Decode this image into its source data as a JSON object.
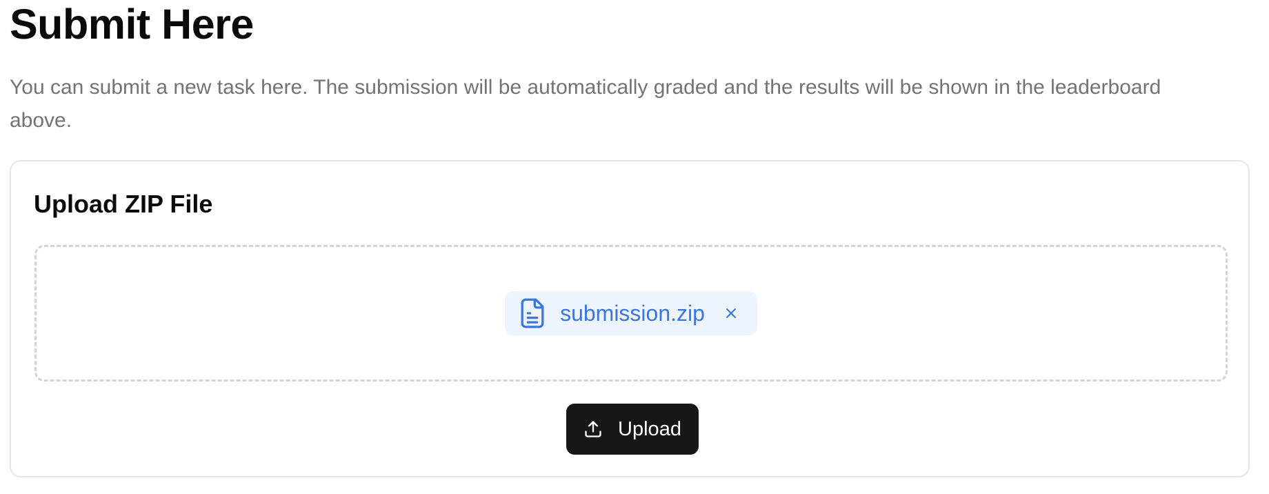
{
  "header": {
    "title": "Submit Here",
    "description": "You can submit a new task here. The submission will be automatically graded and the results will be shown in the leaderboard above."
  },
  "upload_card": {
    "title": "Upload ZIP File",
    "selected_file": {
      "name": "submission.zip",
      "icon": "file-text-icon",
      "remove_icon": "close-icon"
    },
    "upload_button": {
      "label": "Upload",
      "icon": "upload-icon"
    }
  },
  "colors": {
    "accent": "#3b76e0",
    "chip_background": "#eef4fd",
    "button_background": "#171717",
    "muted_text": "#737373",
    "border": "#e5e5e5",
    "dashed_border": "#d4d4d8"
  }
}
